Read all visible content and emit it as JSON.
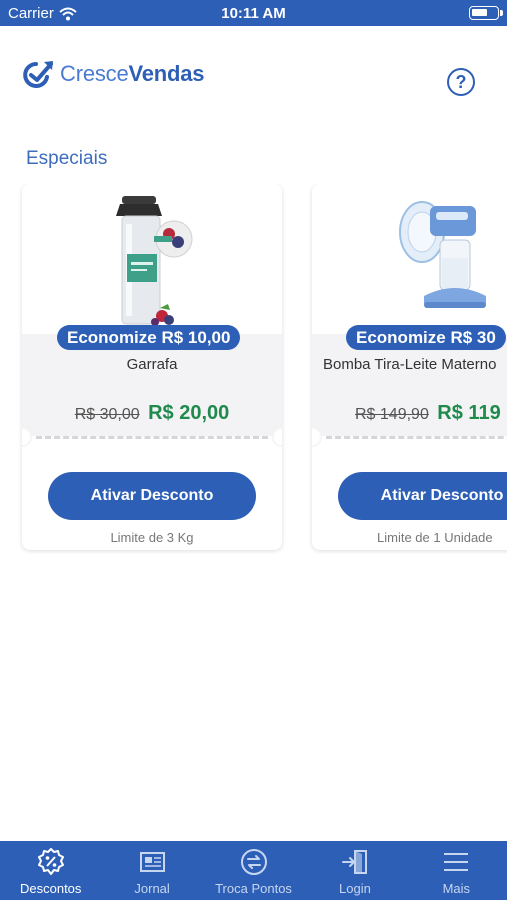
{
  "status_bar": {
    "carrier": "Carrier",
    "time": "10:11 AM",
    "wifi_icon": "wifi-icon",
    "battery_icon": "battery-icon"
  },
  "header": {
    "brand_light": "Cresce",
    "brand_bold": "Vendas",
    "help_label": "?"
  },
  "section": {
    "title": "Especiais"
  },
  "products": [
    {
      "badge": "Economize R$ 10,00",
      "name": "Garrafa",
      "old_price": "R$ 30,00",
      "new_price": "R$ 20,00",
      "button": "Ativar Desconto",
      "limit": "Limite de 3 Kg",
      "image": "water-bottle-image"
    },
    {
      "badge": "Economize R$ 30",
      "name": "Bomba Tira-Leite Materno",
      "old_price": "R$ 149,90",
      "new_price": "R$ 119",
      "button": "Ativar Desconto",
      "limit": "Limite de 1 Unidade",
      "image": "breast-pump-image"
    }
  ],
  "tabbar": {
    "tabs": [
      {
        "label": "Descontos",
        "icon": "discount-icon",
        "active": true
      },
      {
        "label": "Jornal",
        "icon": "newspaper-icon",
        "active": false
      },
      {
        "label": "Troca Pontos",
        "icon": "exchange-icon",
        "active": false
      },
      {
        "label": "Login",
        "icon": "login-icon",
        "active": false
      },
      {
        "label": "Mais",
        "icon": "menu-icon",
        "active": false
      }
    ]
  },
  "colors": {
    "brand_blue": "#2d5fb6",
    "price_green": "#1f8a4c"
  }
}
